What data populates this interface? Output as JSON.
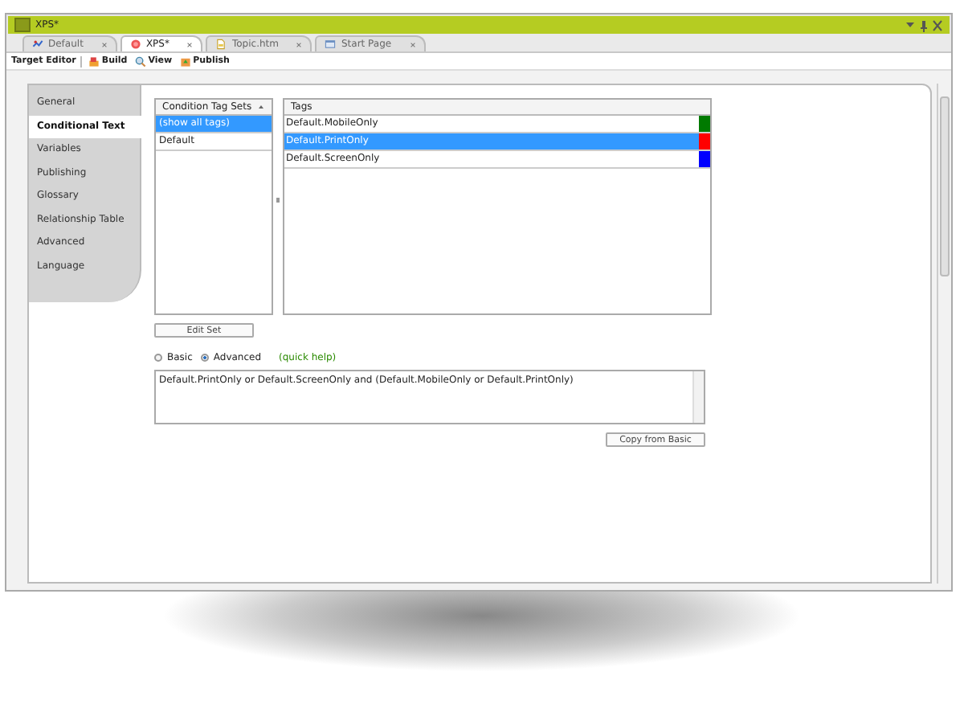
{
  "window": {
    "title": "XPS*"
  },
  "doc_tabs": [
    {
      "label": "Default",
      "selected": false
    },
    {
      "label": "XPS*",
      "selected": true
    },
    {
      "label": "Topic.htm",
      "selected": false
    },
    {
      "label": "Start Page",
      "selected": false
    }
  ],
  "toolbar": {
    "title": "Target Editor",
    "buttons": [
      "Build",
      "View",
      "Publish"
    ]
  },
  "side_tabs": [
    {
      "label": "General",
      "selected": false
    },
    {
      "label": "Conditional Text",
      "selected": true
    },
    {
      "label": "Variables",
      "selected": false
    },
    {
      "label": "Publishing",
      "selected": false
    },
    {
      "label": "Glossary",
      "selected": false
    },
    {
      "label": "Relationship Table",
      "selected": false
    },
    {
      "label": "Advanced",
      "selected": false
    },
    {
      "label": "Language",
      "selected": false
    }
  ],
  "tag_sets": {
    "header": "Condition Tag Sets",
    "items": [
      {
        "label": "(show all tags)",
        "selected": true
      },
      {
        "label": "Default",
        "selected": false
      }
    ]
  },
  "tags": {
    "header": "Tags",
    "items": [
      {
        "label": "Default.MobileOnly",
        "selected": false,
        "color": "#007a00"
      },
      {
        "label": "Default.PrintOnly",
        "selected": true,
        "color": "#ff0000"
      },
      {
        "label": "Default.ScreenOnly",
        "selected": false,
        "color": "#0000ff"
      }
    ]
  },
  "edit_set_button": "Edit Set",
  "mode": [
    {
      "label": "Basic",
      "selected": false
    },
    {
      "label": "Advanced",
      "selected": true
    }
  ],
  "quick_help": "(quick help)",
  "expression": "Default.PrintOnly or Default.ScreenOnly and (Default.MobileOnly or Default.PrintOnly)",
  "copy_button": "Copy from Basic"
}
